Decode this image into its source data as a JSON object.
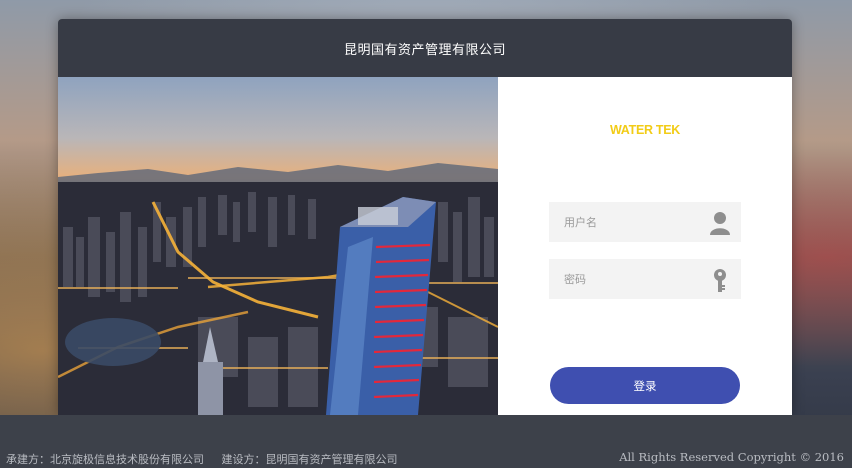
{
  "header": {
    "title": "昆明国有资产管理有限公司"
  },
  "login": {
    "brand": "WATER TEK",
    "username_placeholder": "用户名",
    "password_placeholder": "密码",
    "submit_label": "登录"
  },
  "footer": {
    "builder": "承建方：北京旋极信息技术股份有限公司",
    "owner": "建设方：昆明国有资产管理有限公司",
    "copyright": "All Rights Reserved Copyright © 2016"
  },
  "colors": {
    "header_bg": "#373b45",
    "brand": "#f2cc17",
    "button": "#3f4fb0",
    "footer_bg": "#3d414a"
  },
  "icons": {
    "user": "user-icon",
    "password": "key-icon"
  }
}
